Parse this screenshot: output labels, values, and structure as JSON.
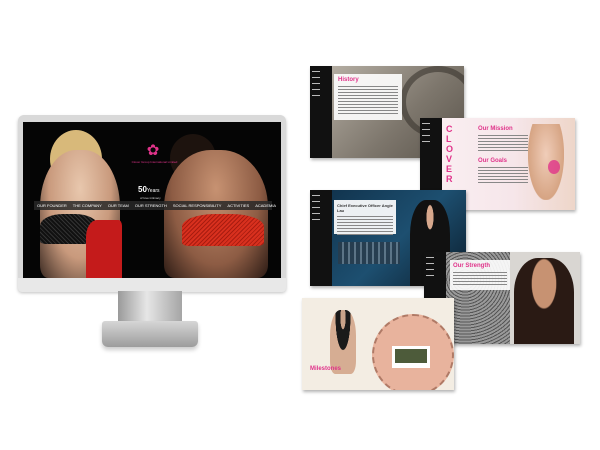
{
  "monitor": {
    "brand_tagline": "Clover Group International Limited",
    "years_headline": "50",
    "years_word": "Years",
    "years_sub": "of love intimacy",
    "nav": [
      "OUR FOUNDER",
      "THE COMPANY",
      "OUR TEAM",
      "OUR STRENGTH",
      "SOCIAL RESPONSIBILITY",
      "ACTIVITIES",
      "ACADEMIA"
    ]
  },
  "slides": {
    "history": {
      "title": "History"
    },
    "mission": {
      "brand_vertical": "CLOVER",
      "title1": "Our Mission",
      "title2": "Our Goals"
    },
    "ceo": {
      "title": "Chief Executive Officer Angie Lau"
    },
    "strength": {
      "title": "Our Strength"
    },
    "milestones": {
      "title": "Milestones"
    }
  },
  "colors": {
    "accent": "#e0338a",
    "dark": "#111111",
    "red": "#c41b1b"
  }
}
